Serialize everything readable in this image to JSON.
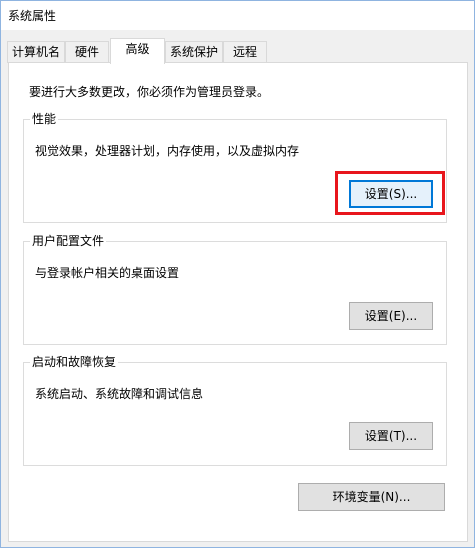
{
  "window": {
    "title": "系统属性"
  },
  "tabs": [
    {
      "label": "计算机名",
      "active": false
    },
    {
      "label": "硬件",
      "active": false
    },
    {
      "label": "高级",
      "active": true
    },
    {
      "label": "系统保护",
      "active": false
    },
    {
      "label": "远程",
      "active": false
    }
  ],
  "advanced": {
    "admin_note": "要进行大多数更改，你必须作为管理员登录。",
    "performance": {
      "title": "性能",
      "description": "视觉效果，处理器计划，内存使用，以及虚拟内存",
      "settings_button": "设置(S)..."
    },
    "user_profiles": {
      "title": "用户配置文件",
      "description": "与登录帐户相关的桌面设置",
      "settings_button": "设置(E)..."
    },
    "startup_recovery": {
      "title": "启动和故障恢复",
      "description": "系统启动、系统故障和调试信息",
      "settings_button": "设置(T)..."
    },
    "env_vars_button": "环境变量(N)..."
  },
  "colors": {
    "highlight_border": "#e8161c",
    "focus_border": "#0078d7"
  }
}
